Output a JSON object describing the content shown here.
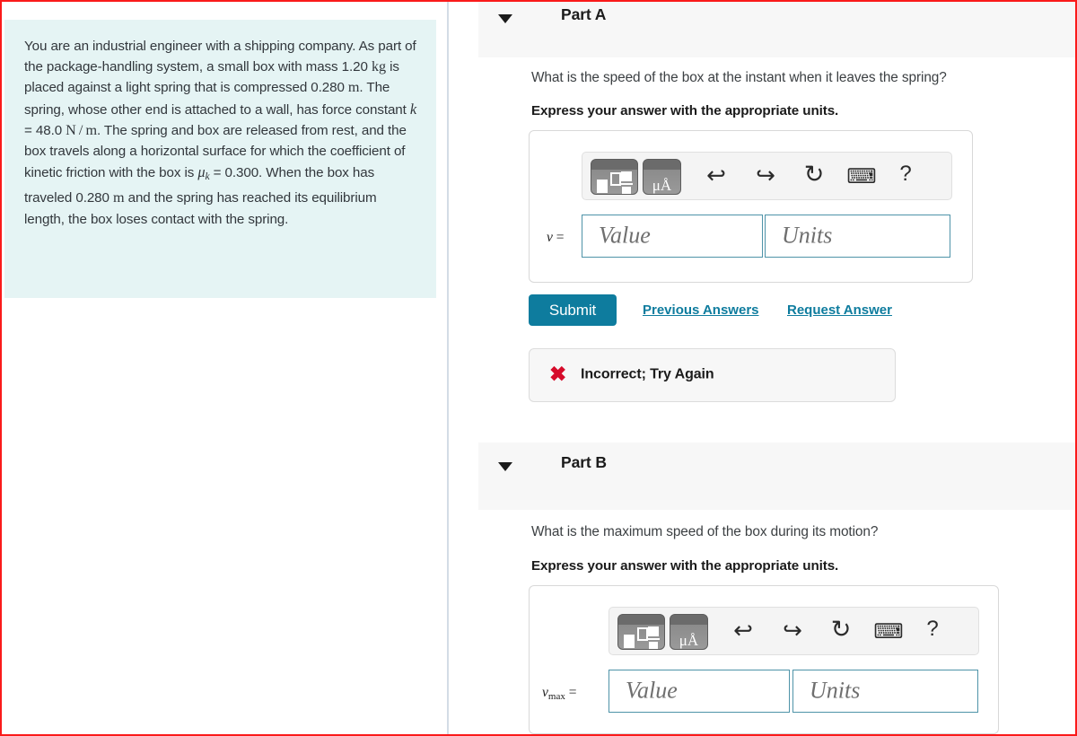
{
  "problem": {
    "segments": [
      {
        "t": "text",
        "v": "You are an industrial engineer with a shipping company. As part of the package-handling system, a small box with mass 1.20 "
      },
      {
        "t": "unit",
        "v": "kg"
      },
      {
        "t": "text",
        "v": " is placed against a light spring that is compressed 0.280 "
      },
      {
        "t": "unit",
        "v": "m"
      },
      {
        "t": "text",
        "v": ". The spring, whose other end is attached to a wall, has force constant "
      },
      {
        "t": "var",
        "v": "k"
      },
      {
        "t": "text",
        "v": " = 48.0 "
      },
      {
        "t": "unit",
        "v": "N/m"
      },
      {
        "t": "text",
        "v": ". The spring and box are released from rest, and the box travels along a horizontal surface for which the coefficient of kinetic friction with the box is "
      },
      {
        "t": "var",
        "v": "μ",
        "sub": "k"
      },
      {
        "t": "text",
        "v": " = 0.300. When the box has traveled 0.280 "
      },
      {
        "t": "unit",
        "v": "m"
      },
      {
        "t": "text",
        "v": " and the spring has reached its equilibrium length, the box loses contact with the spring."
      }
    ],
    "full_text": "You are an industrial engineer with a shipping company. As part of the package-handling system, a small box with mass 1.20 kg is placed against a light spring that is compressed 0.280 m. The spring, whose other end is attached to a wall, has force constant k = 48.0 N/m. The spring and box are released from rest, and the box travels along a horizontal surface for which the coefficient of kinetic friction with the box is μk = 0.300. When the box has traveled 0.280 m and the spring has reached its equilibrium length, the box loses contact with the spring.",
    "background_color": "#e5f4f4",
    "values": {
      "mass": "1.20 kg",
      "compression": "0.280 m",
      "force_constant": "48.0 N/m",
      "friction_coefficient": "0.300",
      "distance_traveled": "0.280 m"
    }
  },
  "toolbar": {
    "math_template_tile": "math-template",
    "units_tile_label": "μÅ",
    "undo": "↩",
    "redo": "↪",
    "reset": "↻",
    "keyboard": "⌨",
    "help": "?"
  },
  "parts": [
    {
      "id": "a",
      "title": "Part A",
      "question": "What is the speed of the box at the instant when it leaves the spring?",
      "instruction": "Express your answer with the appropriate units.",
      "variable": "v",
      "variable_sub": "",
      "value_placeholder": "Value",
      "units_placeholder": "Units",
      "value": "",
      "units": "",
      "submit_label": "Submit",
      "previous_answers_label": "Previous Answers",
      "request_answer_label": "Request Answer",
      "feedback": "Incorrect; Try Again",
      "feedback_icon": "✖"
    },
    {
      "id": "b",
      "title": "Part B",
      "question": "What is the maximum speed of the box during its motion?",
      "instruction": "Express your answer with the appropriate units.",
      "variable": "v",
      "variable_sub": "max",
      "value_placeholder": "Value",
      "units_placeholder": "Units",
      "value": "",
      "units": ""
    }
  ],
  "colors": {
    "accent": "#0e7c9e",
    "problem_bg": "#e5f4f4",
    "header_bg": "#f7f7f7",
    "error": "#d60b2a",
    "border_red": "#fa1a1a",
    "field_border": "#4e93a8"
  }
}
